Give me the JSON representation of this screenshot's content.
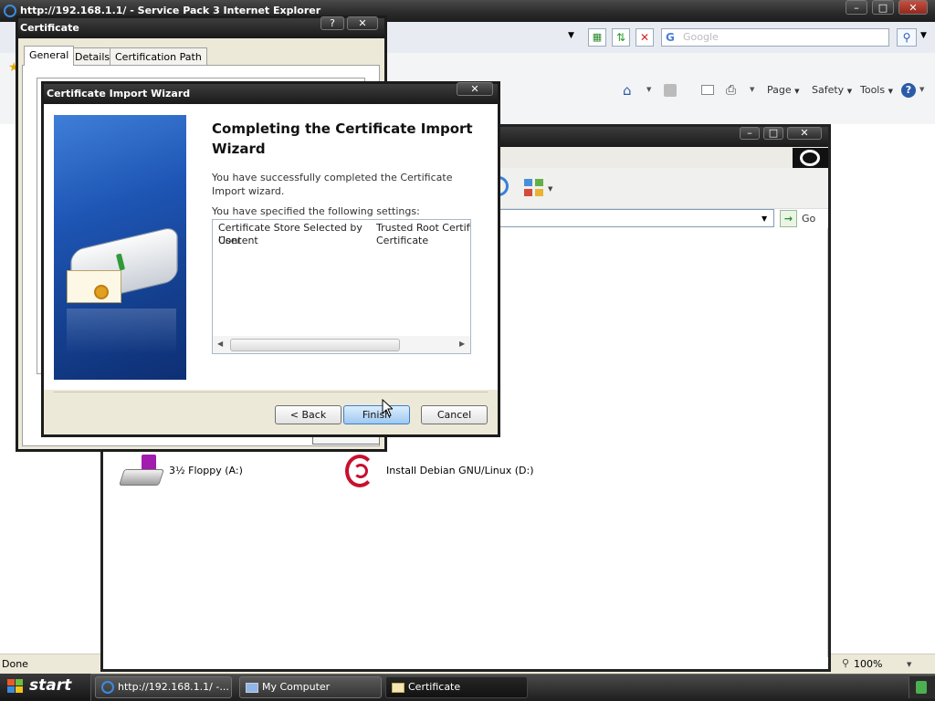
{
  "ie": {
    "title": "http://192.168.1.1/ - Service Pack 3 Internet Explorer",
    "search_placeholder": "Google",
    "commands": {
      "page": "Page",
      "safety": "Safety",
      "tools": "Tools"
    },
    "status": "Done",
    "zoom": "100%"
  },
  "my_computer": {
    "go_label": "Go",
    "items": [
      {
        "label": "3½ Floppy (A:)",
        "icon": "floppy-drive-icon"
      },
      {
        "label": "Install Debian GNU/Linux (D:)",
        "icon": "debian-cd-icon"
      }
    ]
  },
  "certificate": {
    "title": "Certificate",
    "tabs": [
      "General",
      "Details",
      "Certification Path"
    ],
    "active_tab": "General"
  },
  "wizard": {
    "title": "Certificate Import Wizard",
    "heading": "Completing the Certificate Import Wizard",
    "description": "You have successfully completed the Certificate Import wizard.",
    "settings_label": "You have specified the following settings:",
    "settings_rows": [
      {
        "name": "Certificate Store Selected by User",
        "value": "Trusted Root Certific..."
      },
      {
        "name": "Content",
        "value": "Certificate"
      }
    ],
    "buttons": {
      "back": "< Back",
      "finish": "Finish",
      "cancel": "Cancel"
    }
  },
  "taskbar": {
    "start": "start",
    "tasks": [
      {
        "label": "http://192.168.1.1/ -...",
        "icon": "ie-icon"
      },
      {
        "label": "My Computer",
        "icon": "computer-icon"
      },
      {
        "label": "Certificate",
        "icon": "certificate-icon"
      }
    ]
  }
}
